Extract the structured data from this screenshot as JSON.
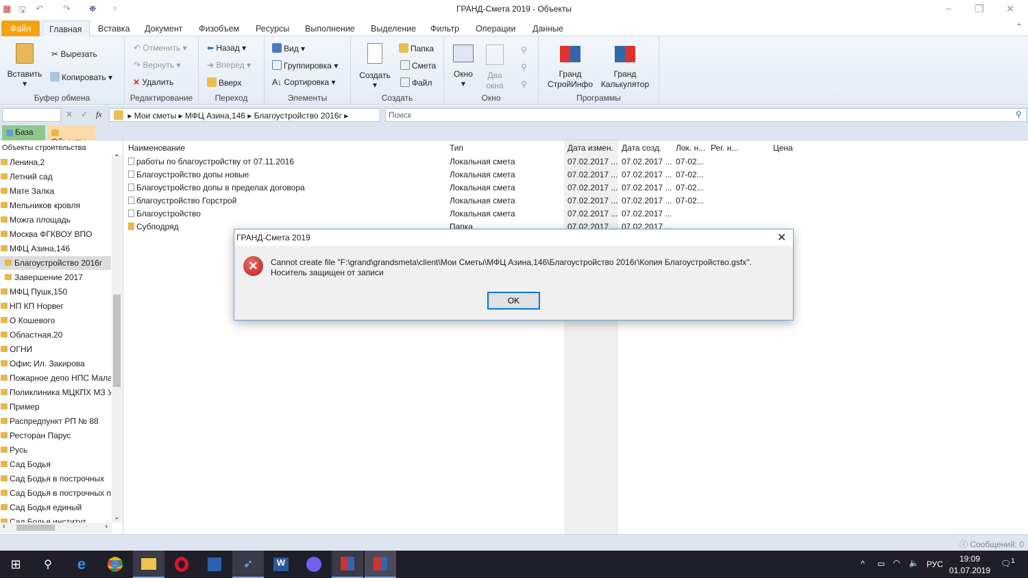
{
  "window": {
    "title": "ГРАНД-Смета 2019 - Объекты"
  },
  "ribbon_tabs": [
    "Файл",
    "Главная",
    "Вставка",
    "Документ",
    "Физобъем",
    "Ресурсы",
    "Выполнение",
    "Выделение",
    "Фильтр",
    "Операции",
    "Данные"
  ],
  "ribbon": {
    "clipboard": {
      "label": "Буфер обмена",
      "paste": "Вставить",
      "cut": "Вырезать",
      "copy": "Копировать"
    },
    "editing": {
      "label": "Редактирование",
      "undo": "Отменить",
      "redo": "Вернуть",
      "delete": "Удалить"
    },
    "navigation": {
      "label": "Переход",
      "back": "Назад",
      "forward": "Вперед",
      "up": "Вверх"
    },
    "elements": {
      "label": "Элементы",
      "view": "Вид",
      "grouping": "Группировка",
      "sorting": "Сортировка"
    },
    "create": {
      "label": "Создать",
      "create": "Создать",
      "folder": "Папка",
      "estimate": "Смета",
      "file": "Файл"
    },
    "window": {
      "label": "Окно",
      "window": "Окно",
      "two_windows": "Два окна"
    },
    "programs": {
      "label": "Программы",
      "stroyinfo": "Гранд СтройИнфо",
      "calc": "Гранд Калькулятор"
    }
  },
  "pathbar": {
    "crumbs": [
      "Мои сметы",
      "МФЦ Азина,146",
      "Благоустройство 2016г"
    ],
    "search_placeholder": "Поиск",
    "fx": "fx"
  },
  "doc_tabs": [
    "База",
    "Объекты"
  ],
  "tree": {
    "header": "Объекты строительства",
    "items": [
      {
        "label": "Ленина,2"
      },
      {
        "label": "Летний сад"
      },
      {
        "label": "Мате Залка"
      },
      {
        "label": "Мельников кровля"
      },
      {
        "label": "Можга площадь"
      },
      {
        "label": "Москва ФГКВОУ ВПО"
      },
      {
        "label": "МФЦ Азина,146"
      },
      {
        "label": "Благоустройство 2016г",
        "child": true,
        "selected": true
      },
      {
        "label": "Завершение 2017",
        "child": true
      },
      {
        "label": "МФЦ Пушк,150"
      },
      {
        "label": "НП КП Норвег"
      },
      {
        "label": "О Кошевого"
      },
      {
        "label": "Областная,20"
      },
      {
        "label": "ОГНИ"
      },
      {
        "label": "Офис Ил. Закирова"
      },
      {
        "label": "Пожарное депо НПС Мала"
      },
      {
        "label": "Поликлиника МЦКПХ МЗ У"
      },
      {
        "label": "Пример"
      },
      {
        "label": "Распредпункт РП № 88"
      },
      {
        "label": "Ресторан Парус"
      },
      {
        "label": "Русь"
      },
      {
        "label": "Сад Бодья"
      },
      {
        "label": "Сад Бодья в построчных"
      },
      {
        "label": "Сад Бодья в построчных пс"
      },
      {
        "label": "Сад Бодья единый"
      },
      {
        "label": "Сад Бодья институт"
      }
    ]
  },
  "table": {
    "columns": [
      "Наименование",
      "Тип",
      "Дата измен.",
      "Дата созд.",
      "Лок. н...",
      "Рег. н...",
      "Цена"
    ],
    "rows": [
      {
        "name": "работы по благоустройству  от 07.11.2016",
        "type": "Локальная смета",
        "mod": "07.02.2017 ...",
        "created": "07.02.2017 ...",
        "lok": "07-02...",
        "folder": false
      },
      {
        "name": "Благоустройство допы новые",
        "type": "Локальная смета",
        "mod": "07.02.2017 ...",
        "created": "07.02.2017 ...",
        "lok": "07-02...",
        "folder": false
      },
      {
        "name": "Благоустройство допы в пределах договора",
        "type": "Локальная смета",
        "mod": "07.02.2017 ...",
        "created": "07.02.2017 ...",
        "lok": "07-02...",
        "folder": false
      },
      {
        "name": "благоустройство Горстрой",
        "type": "Локальная смета",
        "mod": "07.02.2017 ...",
        "created": "07.02.2017 ...",
        "lok": "07-02...",
        "folder": false
      },
      {
        "name": "Благоустройство",
        "type": "Локальная смета",
        "mod": "07.02.2017 ...",
        "created": "07.02.2017 ...",
        "lok": "",
        "folder": false
      },
      {
        "name": "Субподряд",
        "type": "Папка",
        "mod": "07.02.2017 ...",
        "created": "07.02.2017 ...",
        "lok": "",
        "folder": true
      }
    ]
  },
  "dialog": {
    "title": "ГРАНД-Смета 2019",
    "message": "Cannot create file \"F:\\grand\\grandsmeta\\client\\Мои Сметы\\МФЦ Азина,146\\Благоустройство 2016г\\Копия Благоустройство.gsfx\". Носитель защищен от записи",
    "ok": "OK"
  },
  "status": {
    "messages": "Сообщений: 0"
  },
  "taskbar": {
    "lang": "РУС",
    "time": "19:09",
    "date": "01.07.2019",
    "notifications": "1"
  }
}
